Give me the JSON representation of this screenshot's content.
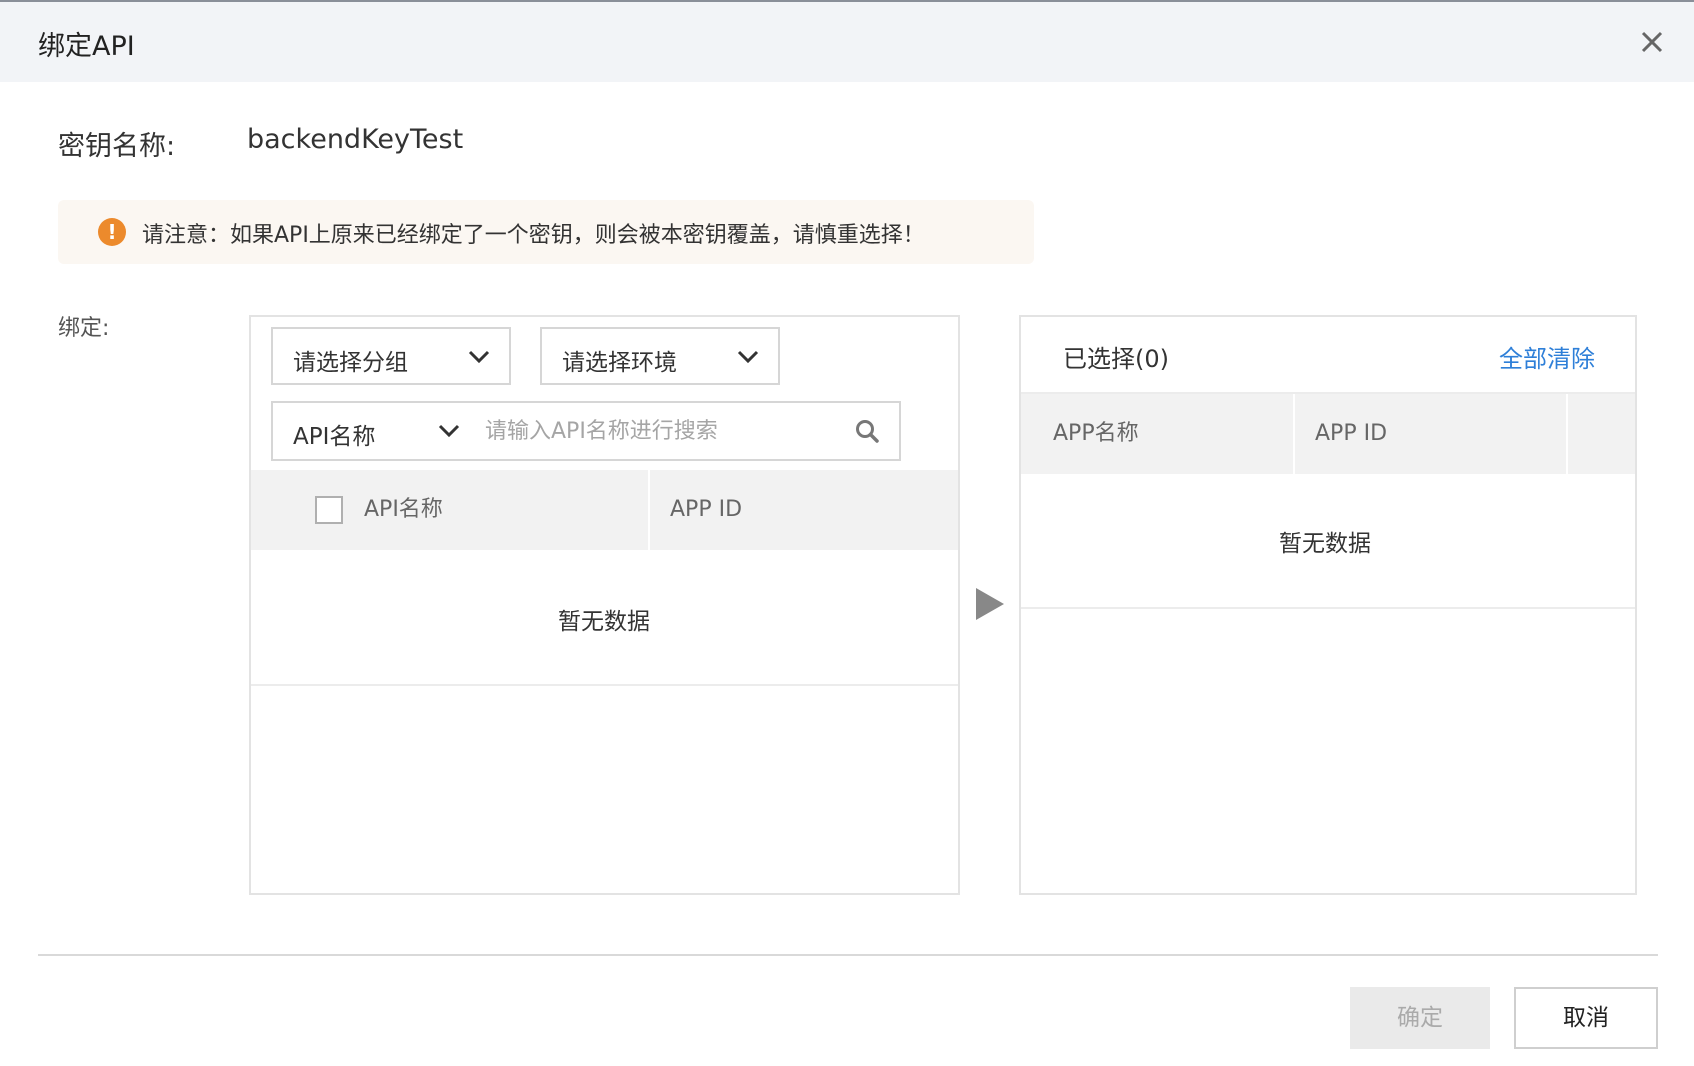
{
  "dialog": {
    "title": "绑定API",
    "close_icon": "close-icon"
  },
  "key": {
    "label": "密钥名称:",
    "value": "backendKeyTest"
  },
  "notice": {
    "icon": "warning-icon",
    "icon_glyph": "!",
    "text": "请注意：如果API上原来已经绑定了一个密钥，则会被本密钥覆盖，请慎重选择！",
    "color": "#ec8a2c"
  },
  "bind": {
    "label": "绑定:"
  },
  "left_panel": {
    "group_select": "请选择分组",
    "env_select": "请选择环境",
    "search_type": "API名称",
    "search_placeholder": "请输入API名称进行搜索",
    "columns": [
      "API名称",
      "APP ID"
    ],
    "empty_text": "暂无数据"
  },
  "right_panel": {
    "title": "已选择(0)",
    "clear_all": "全部清除",
    "clear_all_color": "#2e7fd8",
    "columns": [
      "APP名称",
      "APP ID"
    ],
    "empty_text": "暂无数据"
  },
  "footer": {
    "ok": "确定",
    "cancel": "取消"
  }
}
